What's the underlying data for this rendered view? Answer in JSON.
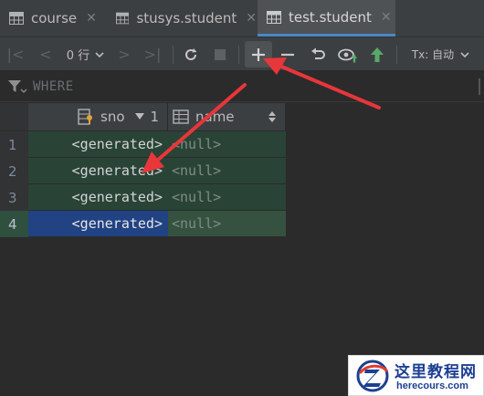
{
  "tabs": [
    {
      "label": "course",
      "active": false
    },
    {
      "label": "stusys.student",
      "active": false
    },
    {
      "label": "test.student",
      "active": true
    }
  ],
  "toolbar": {
    "rows_label": "0 行",
    "tx_label": "Tx: 自动",
    "icons": [
      "first-page-icon",
      "prev-page-icon",
      "rows-dropdown",
      "next-page-icon",
      "last-page-icon",
      "reload-icon",
      "stop-icon",
      "add-row-icon",
      "delete-row-icon",
      "revert-icon",
      "preview-pending-icon",
      "submit-icon",
      "tx-mode-dropdown"
    ]
  },
  "filter": {
    "where_placeholder": "WHERE"
  },
  "table": {
    "columns": [
      {
        "label": "sno",
        "sort_order": "1",
        "icon": "key-column-icon"
      },
      {
        "label": "name",
        "icon": "column-icon"
      }
    ],
    "rows": [
      {
        "num": "1",
        "sno": "<generated>",
        "name": "<null>"
      },
      {
        "num": "2",
        "sno": "<generated>",
        "name": "<null>"
      },
      {
        "num": "3",
        "sno": "<generated>",
        "name": "<null>"
      },
      {
        "num": "4",
        "sno": "<generated>",
        "name": "<null>",
        "selected": true
      }
    ]
  },
  "watermark": {
    "title": "这里教程网",
    "url": "herecours.com"
  },
  "colors": {
    "accent": "#4a88c7",
    "annotation_arrow": "#e8363b",
    "inserted_row": "#294436",
    "selected_cell": "#214283",
    "submit_green": "#59a869"
  }
}
